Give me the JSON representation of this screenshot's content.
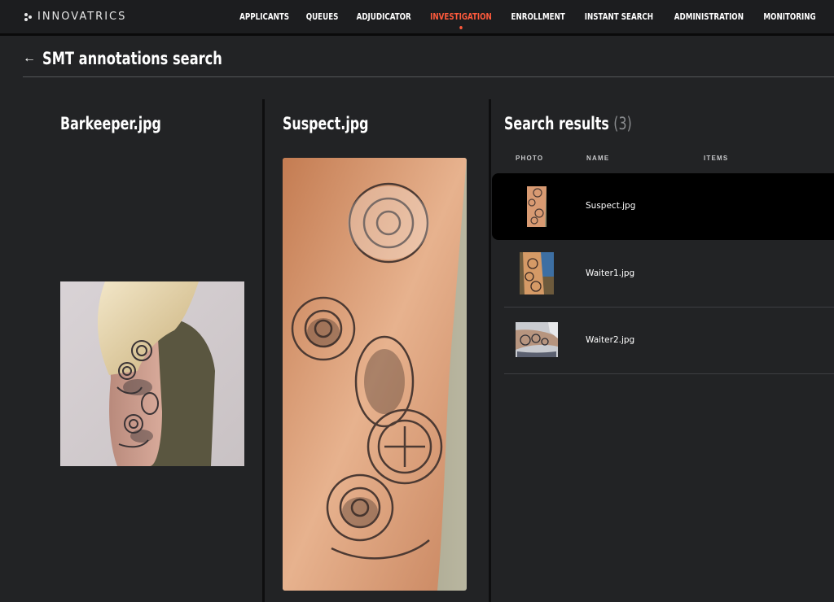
{
  "brand": {
    "name": "INNOVATRICS"
  },
  "nav": {
    "items": [
      {
        "label": "APPLICANTS",
        "active": false
      },
      {
        "label": "QUEUES",
        "active": false
      },
      {
        "label": "ADJUDICATOR",
        "active": false
      },
      {
        "label": "INVESTIGATION",
        "active": true
      },
      {
        "label": "ENROLLMENT",
        "active": false
      },
      {
        "label": "INSTANT SEARCH",
        "active": false
      },
      {
        "label": "ADMINISTRATION",
        "active": false
      },
      {
        "label": "MONITORING",
        "active": false
      }
    ],
    "active_color": "#ff5a3c"
  },
  "page": {
    "back_icon": "arrow-left-icon",
    "title": "SMT annotations search"
  },
  "query": {
    "title": "Barkeeper.jpg"
  },
  "candidate": {
    "title": "Suspect.jpg"
  },
  "results": {
    "title": "Search results",
    "count": "(3)",
    "columns": {
      "photo": "PHOTO",
      "name": "NAME",
      "items": "ITEMS"
    },
    "rows": [
      {
        "name": "Suspect.jpg",
        "selected": true
      },
      {
        "name": "Waiter1.jpg",
        "selected": false
      },
      {
        "name": "Waiter2.jpg",
        "selected": false
      }
    ]
  },
  "colors": {
    "background": "#222325",
    "accent": "#ff5a3c",
    "selected_row": "#000000"
  }
}
